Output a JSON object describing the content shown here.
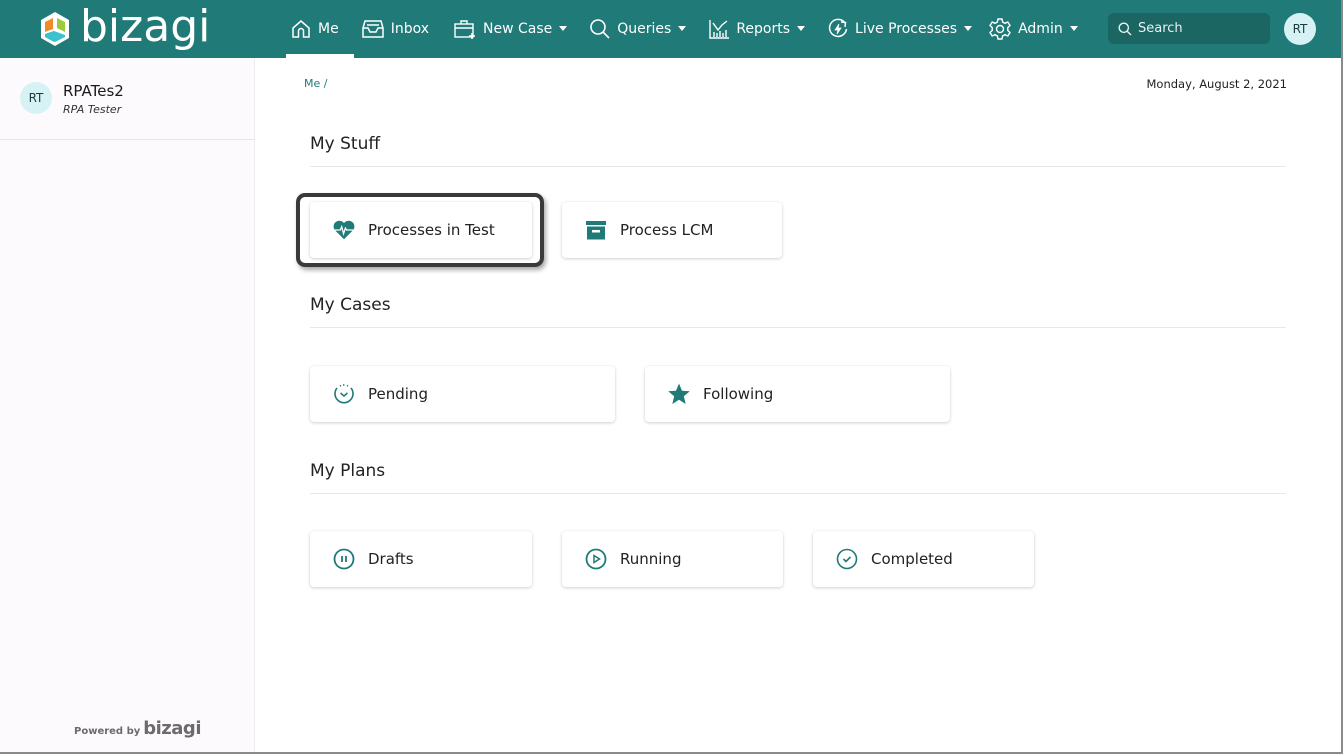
{
  "app": {
    "brand": "bizagi",
    "brand_colors": {
      "primary": "#1f7a78",
      "logo_orange": "#f28a2a",
      "logo_green": "#9acb3c",
      "logo_cyan": "#3cc1cf"
    }
  },
  "topbar": {
    "nav": [
      {
        "label": "Me",
        "icon": "home-icon",
        "active": true,
        "dropdown": false
      },
      {
        "label": "Inbox",
        "icon": "inbox-icon",
        "active": false,
        "dropdown": false
      },
      {
        "label": "New Case",
        "icon": "new-case-icon",
        "active": false,
        "dropdown": true
      },
      {
        "label": "Queries",
        "icon": "search-icon",
        "active": false,
        "dropdown": true
      },
      {
        "label": "Reports",
        "icon": "reports-icon",
        "active": false,
        "dropdown": true
      },
      {
        "label": "Live Processes",
        "icon": "live-processes-icon",
        "active": false,
        "dropdown": true
      },
      {
        "label": "Admin",
        "icon": "gear-icon",
        "active": false,
        "dropdown": true
      }
    ],
    "search": {
      "placeholder": "Search",
      "value": ""
    },
    "avatar_initials": "RT"
  },
  "sidebar": {
    "user": {
      "initials": "RT",
      "name": "RPATes2",
      "role": "RPA Tester"
    },
    "powered_by": {
      "prefix": "Powered by",
      "brand": "bizagi"
    }
  },
  "main": {
    "breadcrumb": "Me /",
    "date": "Monday, August 2, 2021",
    "sections": [
      {
        "title": "My Stuff",
        "cards": [
          {
            "label": "Processes in Test",
            "icon": "heartbeat-icon",
            "highlighted": true
          },
          {
            "label": "Process LCM",
            "icon": "archive-box-icon",
            "highlighted": false
          }
        ]
      },
      {
        "title": "My Cases",
        "cards": [
          {
            "label": "Pending",
            "icon": "clock-icon",
            "highlighted": false
          },
          {
            "label": "Following",
            "icon": "star-icon",
            "highlighted": false
          }
        ]
      },
      {
        "title": "My Plans",
        "cards": [
          {
            "label": "Drafts",
            "icon": "pause-circle-icon",
            "highlighted": false
          },
          {
            "label": "Running",
            "icon": "play-circle-icon",
            "highlighted": false
          },
          {
            "label": "Completed",
            "icon": "check-circle-icon",
            "highlighted": false
          }
        ]
      }
    ]
  }
}
